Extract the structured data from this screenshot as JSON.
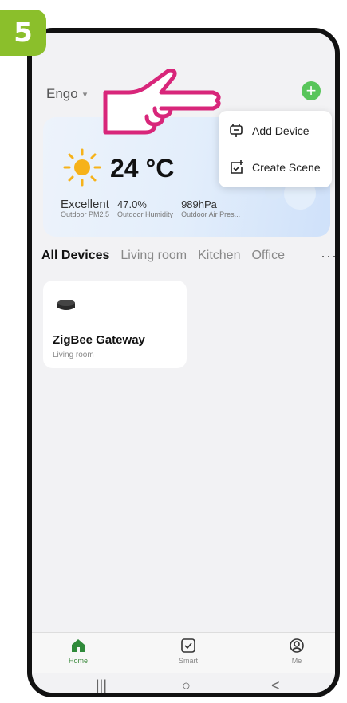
{
  "step_number": "5",
  "header": {
    "home_name": "Engo",
    "caret": "▾",
    "add_symbol": "+"
  },
  "weather": {
    "temperature": "24 °C",
    "stats": [
      {
        "value": "Excellent",
        "label": "Outdoor PM2.5"
      },
      {
        "value": "47.0%",
        "label": "Outdoor Humidity"
      },
      {
        "value": "989hPa",
        "label": "Outdoor Air Pres..."
      }
    ]
  },
  "menu": {
    "items": [
      {
        "label": "Add Device",
        "icon": "add-device-icon"
      },
      {
        "label": "Create Scene",
        "icon": "create-scene-icon"
      }
    ]
  },
  "tabs": {
    "items": [
      "All Devices",
      "Living room",
      "Kitchen",
      "Office"
    ],
    "more": "···"
  },
  "device": {
    "name": "ZigBee Gateway",
    "room": "Living room"
  },
  "bottom_nav": {
    "items": [
      {
        "label": "Home",
        "icon": "home-icon"
      },
      {
        "label": "Smart",
        "icon": "smart-icon"
      },
      {
        "label": "Me",
        "icon": "profile-icon"
      }
    ]
  },
  "system_nav": {
    "recent": "|||",
    "home": "○",
    "back": "<"
  },
  "colors": {
    "accent_green": "#58c55a",
    "badge_green": "#8bbf2b",
    "hand_magenta": "#d8267a"
  }
}
